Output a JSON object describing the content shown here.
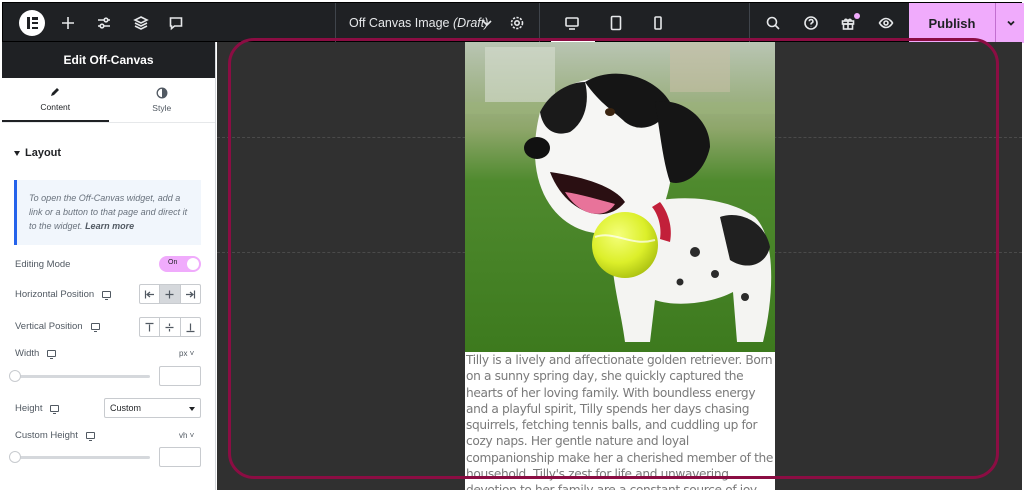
{
  "topbar": {
    "page_title": "Off Canvas Image",
    "page_status": "(Draft)",
    "publish_label": "Publish",
    "icons": [
      "elementor-logo-icon",
      "add-icon",
      "settings-sliders-icon",
      "layers-icon",
      "comments-icon",
      "chevron-down-icon",
      "gear-icon",
      "desktop-icon",
      "tablet-icon",
      "mobile-icon",
      "search-icon",
      "help-icon",
      "gift-icon",
      "eye-icon"
    ],
    "accent_color": "#f0abfc"
  },
  "panel": {
    "title": "Edit Off-Canvas",
    "tabs": [
      {
        "label": "Content",
        "icon": "pencil-icon",
        "active": true
      },
      {
        "label": "Style",
        "icon": "contrast-icon",
        "active": false
      }
    ],
    "section_title": "Layout",
    "notice_text": "To open the Off-Canvas widget, add a link or a button to that page and direct it to the widget.",
    "notice_link": "Learn more",
    "editing_mode_label": "Editing Mode",
    "editing_mode_value": "On",
    "horizontal_position_label": "Horizontal Position",
    "vertical_position_label": "Vertical Position",
    "width_label": "Width",
    "width_unit": "px",
    "height_label": "Height",
    "height_value": "Custom",
    "custom_height_label": "Custom Height",
    "custom_height_unit": "vh"
  },
  "canvas": {
    "bio": "Tilly is a lively and affectionate golden retriever. Born on a sunny spring day, she quickly captured the hearts of her loving family. With boundless energy and a playful spirit, Tilly spends her days chasing squirrels, fetching tennis balls, and cuddling up for cozy naps. Her gentle nature and loyal companionship make her a cherished member of the household. Tilly's zest for life and unwavering devotion to her family are a constant source of joy and laughter.",
    "highlight_color": "#8b0d43"
  }
}
